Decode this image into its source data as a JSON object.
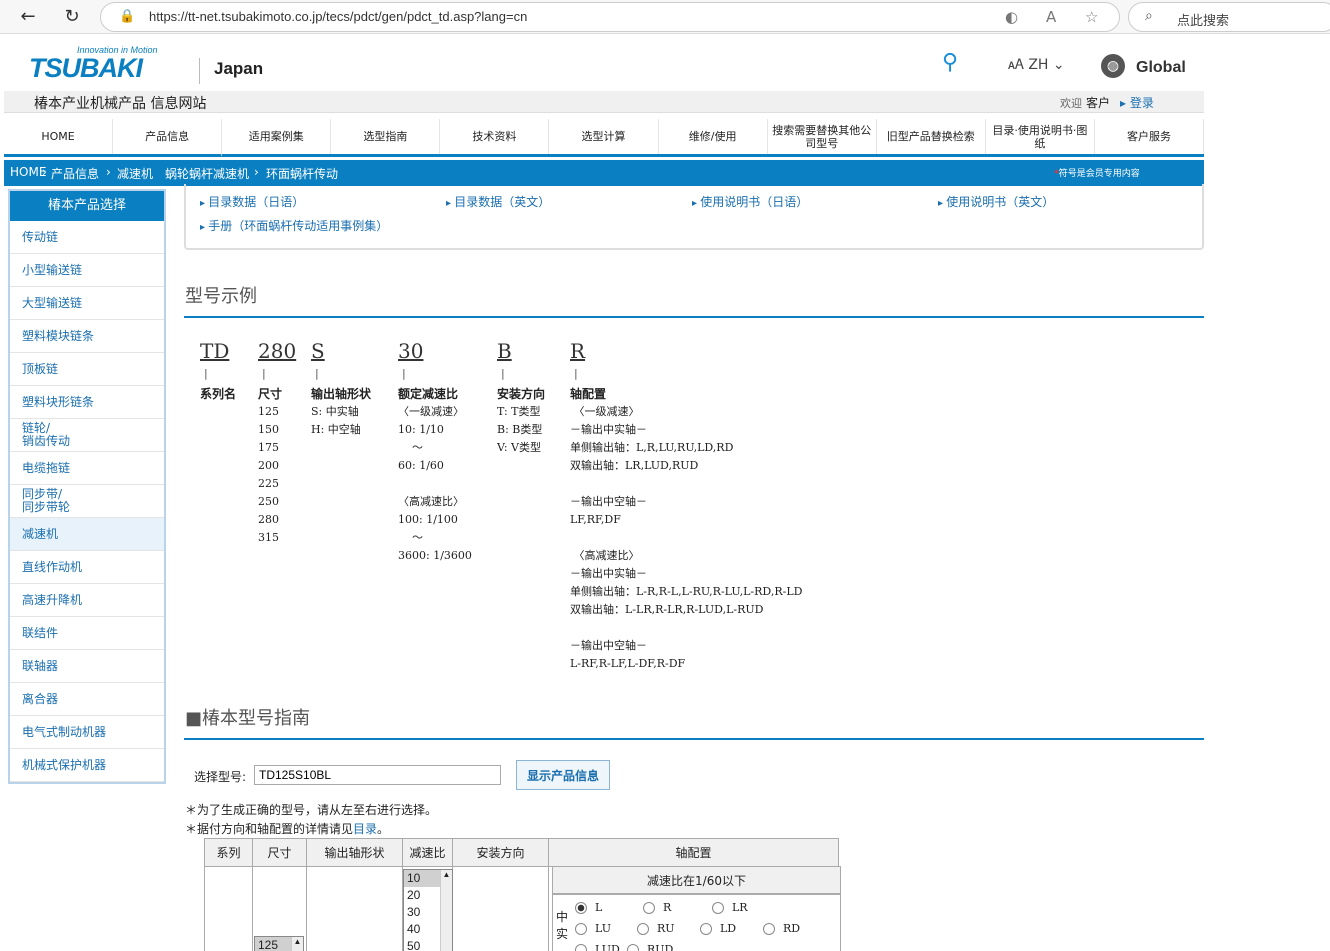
{
  "browser": {
    "url": "https://tt-net.tsubakimoto.co.jp/tecs/pdct/gen/pdct_td.asp?lang=cn",
    "search_placeholder": "点此搜索"
  },
  "header": {
    "logo_tagline": "Innovation in Motion",
    "logo_word": "TSUBAKI",
    "region": "Japan",
    "lang": "ZH",
    "global": "Global",
    "site_title": "椿本产业机械产品 信息网站",
    "welcome": "欢迎",
    "customer": "客户",
    "login": "登录"
  },
  "nav": [
    "HOME",
    "产品信息",
    "适用案例集",
    "选型指南",
    "技术资料",
    "选型计算",
    "维修/使用",
    "搜索需要替换其他公司型号",
    "旧型产品替换检索",
    "目录·使用说明书·图纸",
    "客户服务"
  ],
  "breadcrumb": {
    "items": [
      "HOME",
      "产品信息",
      "减速机",
      "蜗轮蜗杆减速机",
      "环面蜗杆传动"
    ],
    "note_mark": "*",
    "note": "符号是会员专用内容"
  },
  "sidebar": {
    "title": "椿本产品选择",
    "items": [
      "传动链",
      "小型输送链",
      "大型输送链",
      "塑料模块链条",
      "顶板链",
      "塑料块形链条",
      "链轮/\n销齿传动",
      "电缆拖链",
      "同步带/\n同步带轮",
      "减速机",
      "直线作动机",
      "高速升降机",
      "联结件",
      "联轴器",
      "离合器",
      "电气式制动机器",
      "机械式保护机器"
    ]
  },
  "downloads": [
    "目录数据（日语）",
    "目录数据（英文）",
    "使用说明书（日语）",
    "使用说明书（英文）",
    "手册（环面蜗杆传动适用事例集）"
  ],
  "model_example": {
    "heading": "型号示例",
    "codes": [
      "TD",
      "280",
      "S",
      "30",
      "B",
      "R"
    ],
    "labels": [
      "系列名",
      "尺寸",
      "输出轴形状",
      "额定减速比",
      "安装方向",
      "轴配置"
    ],
    "sizes": "125\n150\n175\n200\n225\n250\n280\n315",
    "shaft": "S: 中实轴\nH: 中空轴",
    "ratio": "〈一级减速〉\n10: 1/10\n    ～\n60: 1/60\n\n〈高减速比〉\n100: 1/100\n    ～\n3600: 1/3600",
    "mount": "T: T类型\nB: B类型\nV: V类型",
    "axis": " 〈一级减速〉\n－输出中实轴－\n单侧输出轴：L,R,LU,RU,LD,RD\n双输出轴：LR,LUD,RUD\n\n－输出中空轴－\nLF,RF,DF\n\n 〈高减速比〉\n－输出中实轴－\n单侧输出轴：L-R,R-L,L-RU,R-LU,L-RD,R-LD\n双输出轴：L-LR,R-LR,R-LUD,L-RUD\n\n－输出中空轴－\nL-RF,R-LF,L-DF,R-DF"
  },
  "guide": {
    "heading": "■椿本型号指南",
    "select_label": "选择型号:",
    "model_value": "TD125S10BL",
    "show_button": "显示产品信息",
    "note1": "＊为了生成正确的型号，请从左至右进行选择。",
    "note2_prefix": "＊据付方向和轴配置的详情请见",
    "note2_link": "目录",
    "note2_suffix": "。",
    "table_headers": [
      "系列",
      "尺寸",
      "输出轴形状",
      "减速比",
      "安装方向",
      "轴配置"
    ],
    "ratio_options": [
      "10",
      "20",
      "30",
      "40",
      "50"
    ],
    "size_options": [
      "125"
    ],
    "ratio_head": "减速比在1/60以下",
    "axis_group": "中实",
    "radio_row1": [
      "L",
      "R",
      "LR"
    ],
    "radio_row2": [
      "LU",
      "RU",
      "LD",
      "RD"
    ],
    "radio_row3": [
      "LUD",
      "RUD"
    ]
  }
}
